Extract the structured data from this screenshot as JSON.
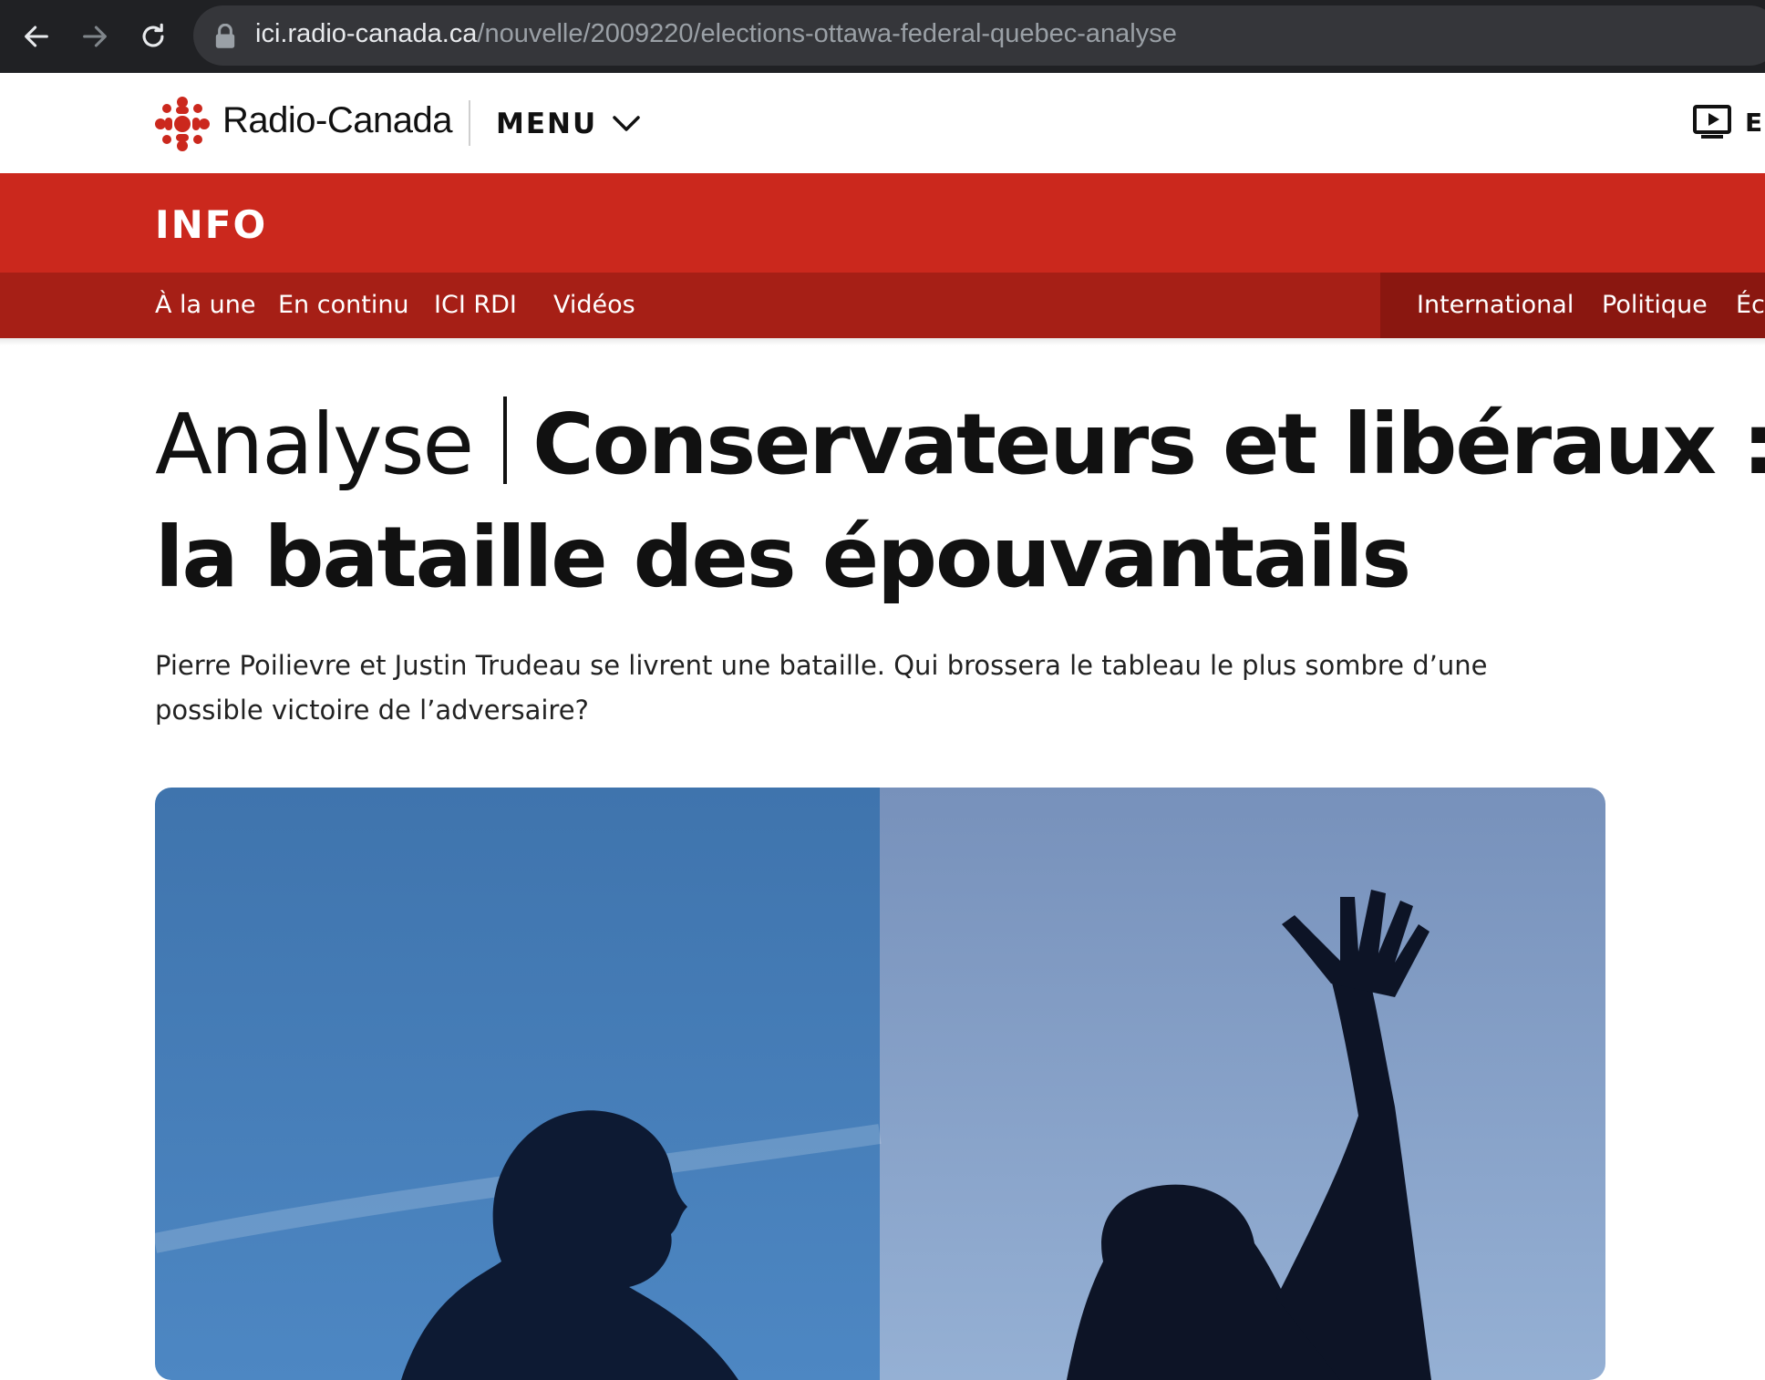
{
  "browser": {
    "url_host": "ici.radio-canada.ca",
    "url_path": "/nouvelle/2009220/elections-ottawa-federal-quebec-analyse",
    "icons": [
      "back-icon",
      "forward-icon",
      "reload-icon",
      "lock-icon"
    ]
  },
  "header": {
    "logo_text": "Radio-Canada",
    "menu_label": "MENU",
    "lang_label": "EN",
    "lang_visible": "E"
  },
  "section": {
    "band_label": "INFO",
    "nav_left": [
      "À la une",
      "En continu",
      "ICI RDI",
      "Vidéos"
    ],
    "nav_right": [
      "International",
      "Politique",
      "Éc"
    ]
  },
  "article": {
    "kicker": "Analyse",
    "title_line1": "Conservateurs et libéraux :",
    "title_line2": "la bataille des épouvantails",
    "dek": "Pierre Poilievre et Justin Trudeau se livrent une bataille. Qui brossera le tableau le plus sombre d’une possible victoire de l’adversaire?"
  },
  "colors": {
    "brand_red": "#cb281d",
    "nav_red": "#a61f16",
    "nav_red_dark": "#8a1710",
    "chrome_bg": "#202124"
  }
}
